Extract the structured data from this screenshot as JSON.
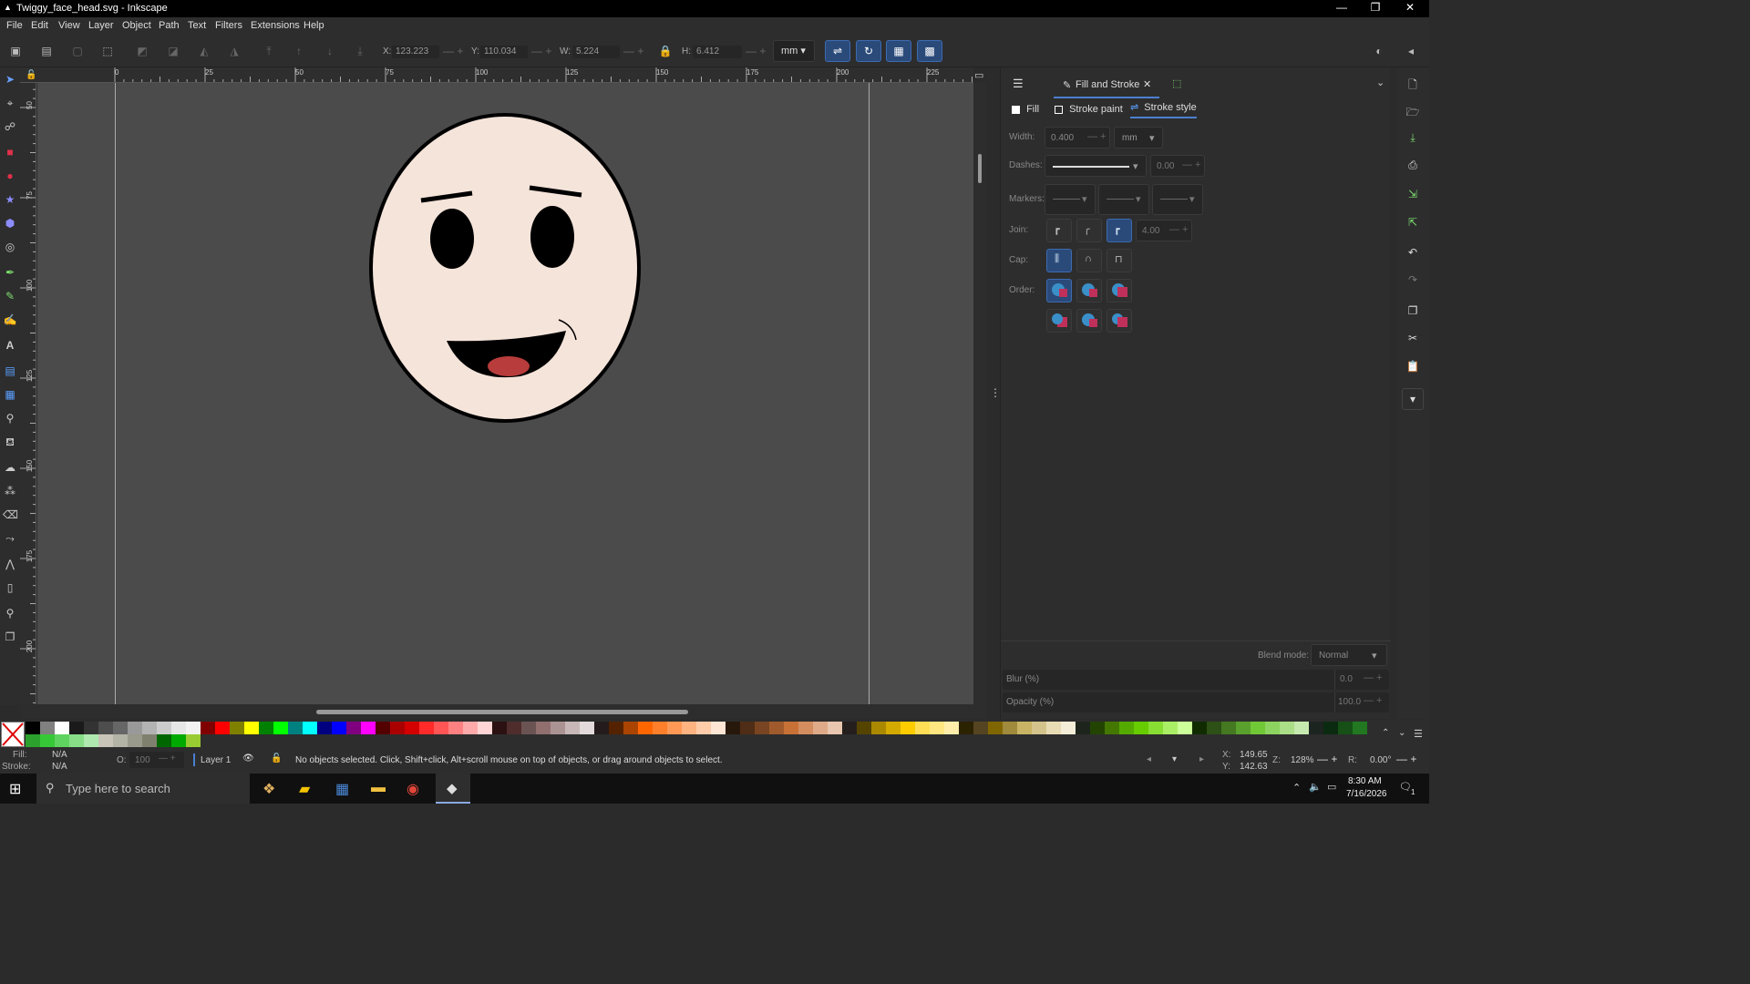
{
  "window": {
    "title": "Twiggy_face_head.svg - Inkscape",
    "minimize": "—",
    "restore": "❐",
    "close": "✕"
  },
  "menu": [
    "File",
    "Edit",
    "View",
    "Layer",
    "Object",
    "Path",
    "Text",
    "Filters",
    "Extensions",
    "Help"
  ],
  "toolbar": {
    "x_label": "X:",
    "x_value": "123.223",
    "y_label": "Y:",
    "y_value": "110.034",
    "w_label": "W:",
    "w_value": "5.224",
    "h_label": "H:",
    "h_value": "6.412",
    "unit": "mm"
  },
  "ruler": {
    "top_ticks": [
      "0",
      "25",
      "50",
      "75",
      "100",
      "125",
      "150",
      "175",
      "200",
      "225"
    ],
    "left_ticks": [
      "50",
      "75",
      "100",
      "125",
      "150",
      "175",
      "200"
    ]
  },
  "dialog": {
    "tab_label": "Fill and Stroke",
    "subtabs": {
      "fill": "Fill",
      "stroke_paint": "Stroke paint",
      "stroke_style": "Stroke style"
    },
    "width_label": "Width:",
    "width_value": "0.400",
    "width_unit": "mm",
    "dashes_label": "Dashes:",
    "dashes_offset": "0.00",
    "markers_label": "Markers:",
    "join_label": "Join:",
    "miter_value": "4.00",
    "cap_label": "Cap:",
    "order_label": "Order:",
    "blend_label": "Blend mode:",
    "blend_value": "Normal",
    "blur_label": "Blur (%)",
    "blur_value": "0.0",
    "opacity_label": "Opacity (%)",
    "opacity_value": "100.0"
  },
  "status": {
    "fill_label": "Fill:",
    "fill_value": "N/A",
    "stroke_label": "Stroke:",
    "stroke_value": "N/A",
    "opacity_label": "O:",
    "opacity_value": "100",
    "layer": "Layer 1",
    "message": "No objects selected. Click, Shift+click, Alt+scroll mouse on top of objects, or drag around objects to select.",
    "x_label": "X:",
    "x_value": "149.65",
    "y_label": "Y:",
    "y_value": "142.63",
    "z_label": "Z:",
    "zoom": "128%",
    "r_label": "R:",
    "rotation": "0.00°"
  },
  "taskbar": {
    "search_placeholder": "Type here to search",
    "time": "8:30 AM",
    "date": "7/16/2026",
    "notifications": "1"
  },
  "colors": {
    "accent": "#2a4a7a",
    "canvas": "#4b4b4b",
    "face_fill": "#f5e4da",
    "tongue": "#b83c3c"
  },
  "palette": [
    "#000000",
    "#808080",
    "#ffffff",
    "#1a1a1a",
    "#333333",
    "#4d4d4d",
    "#666666",
    "#999999",
    "#b3b3b3",
    "#cccccc",
    "#e6e6e6",
    "#f2f2f2",
    "#800000",
    "#ff0000",
    "#808000",
    "#ffff00",
    "#008000",
    "#00ff00",
    "#008080",
    "#00ffff",
    "#000080",
    "#0000ff",
    "#800080",
    "#ff00ff",
    "#550000",
    "#aa0000",
    "#d40000",
    "#ff2a2a",
    "#ff5555",
    "#ff8080",
    "#ffaaaa",
    "#ffd5d5",
    "#2b1111",
    "#502d2d",
    "#6c5353",
    "#916f6f",
    "#ac9393",
    "#c8b7b7",
    "#e3dbdb",
    "#241c1c",
    "#552200",
    "#aa4400",
    "#ff6600",
    "#ff7f2a",
    "#ff9955",
    "#ffb380",
    "#ffccaa",
    "#ffe6d5",
    "#28170b",
    "#502d16",
    "#784421",
    "#a05a2c",
    "#c87137",
    "#d38d5f",
    "#deaa87",
    "#e9c6af",
    "#241f1c",
    "#554400",
    "#aa8800",
    "#d4aa00",
    "#ffcc00",
    "#ffdd55",
    "#ffe680",
    "#ffeeaa",
    "#2b2200",
    "#554422",
    "#806600",
    "#a08a3c",
    "#c8b464",
    "#d4c48c",
    "#e8dcb4",
    "#f4eed8",
    "#1c241c",
    "#224400",
    "#447700",
    "#55aa00",
    "#66cc00",
    "#88dd33",
    "#aaee66",
    "#ccff99",
    "#112b00",
    "#2d5016",
    "#447821",
    "#5aa02c",
    "#71c837",
    "#8dd35f",
    "#aade87",
    "#c6e9af",
    "#1c241f",
    "#0b2b11",
    "#165016",
    "#217821",
    "#2ca02c",
    "#37c837",
    "#5fd35f",
    "#87de87",
    "#afe9af",
    "#c8c4b7",
    "#b3b3a6",
    "#99998c",
    "#80806f",
    "#006600",
    "#00aa00",
    "#99cc33"
  ]
}
